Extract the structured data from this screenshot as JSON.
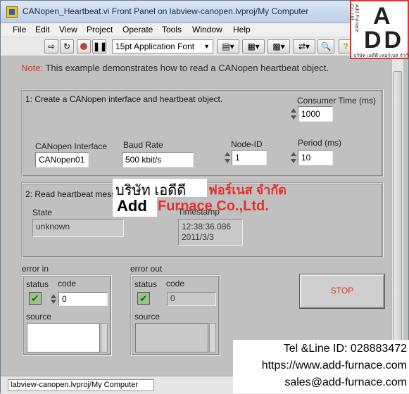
{
  "window": {
    "title": "CANopen_Heartbeat.vi Front Panel on labview-canopen.lvproj/My Computer"
  },
  "menu": [
    "File",
    "Edit",
    "View",
    "Project",
    "Operate",
    "Tools",
    "Window",
    "Help"
  ],
  "toolbar": {
    "font_select": "15pt Application Font"
  },
  "note": {
    "label": "Note:",
    "text": " This example demonstrates how to read a CANopen heartbeat object."
  },
  "section1": {
    "title": "1: Create a CANopen interface and heartbeat object.",
    "consumer_time_label": "Consumer Time (ms)",
    "consumer_time_value": "1000",
    "interface_label": "CANopen Interface",
    "interface_value": "CANopen01",
    "baud_label": "Baud Rate",
    "baud_value": "500 kbit/s",
    "node_label": "Node-ID",
    "node_value": "1",
    "period_label": "Period (ms)",
    "period_value": "10"
  },
  "section2": {
    "title": "2: Read heartbeat messa",
    "state_label": "State",
    "state_value": "unknown",
    "timestamp_label": "Timestamp",
    "timestamp_time": "12:38:36.086",
    "timestamp_date": "2011/3/3"
  },
  "error_in": {
    "title": "error in",
    "status_label": "status",
    "code_label": "code",
    "code_value": "0",
    "source_label": "source"
  },
  "error_out": {
    "title": "error out",
    "status_label": "status",
    "code_label": "code",
    "code_value": "0",
    "source_label": "source"
  },
  "stop_label": "STOP",
  "status_bar": {
    "path": "labview-canopen.lvproj/My Computer"
  },
  "watermark": {
    "logo_a": "A",
    "logo_dd": "DD",
    "logo_company": "Add Furnace Co.,Ltd.",
    "logo_thai": "บริษัท เอดีดี เฟอร์เนส จำกัด",
    "thai_name_white": "บริษัท เอดีดี",
    "thai_name_red": "ฟอร์เนส จำกัด",
    "add_text": "Add",
    "furnace_text": "Furnace Co.,Ltd.",
    "tel": "Tel &Line ID: 028883472",
    "web": "https://www.add-furnace.com",
    "email": "sales@add-furnace.com"
  },
  "colors": {
    "accent_red": "#e0391a",
    "panel_gray": "#c0c0c0",
    "watermark_red": "#e6312a"
  }
}
